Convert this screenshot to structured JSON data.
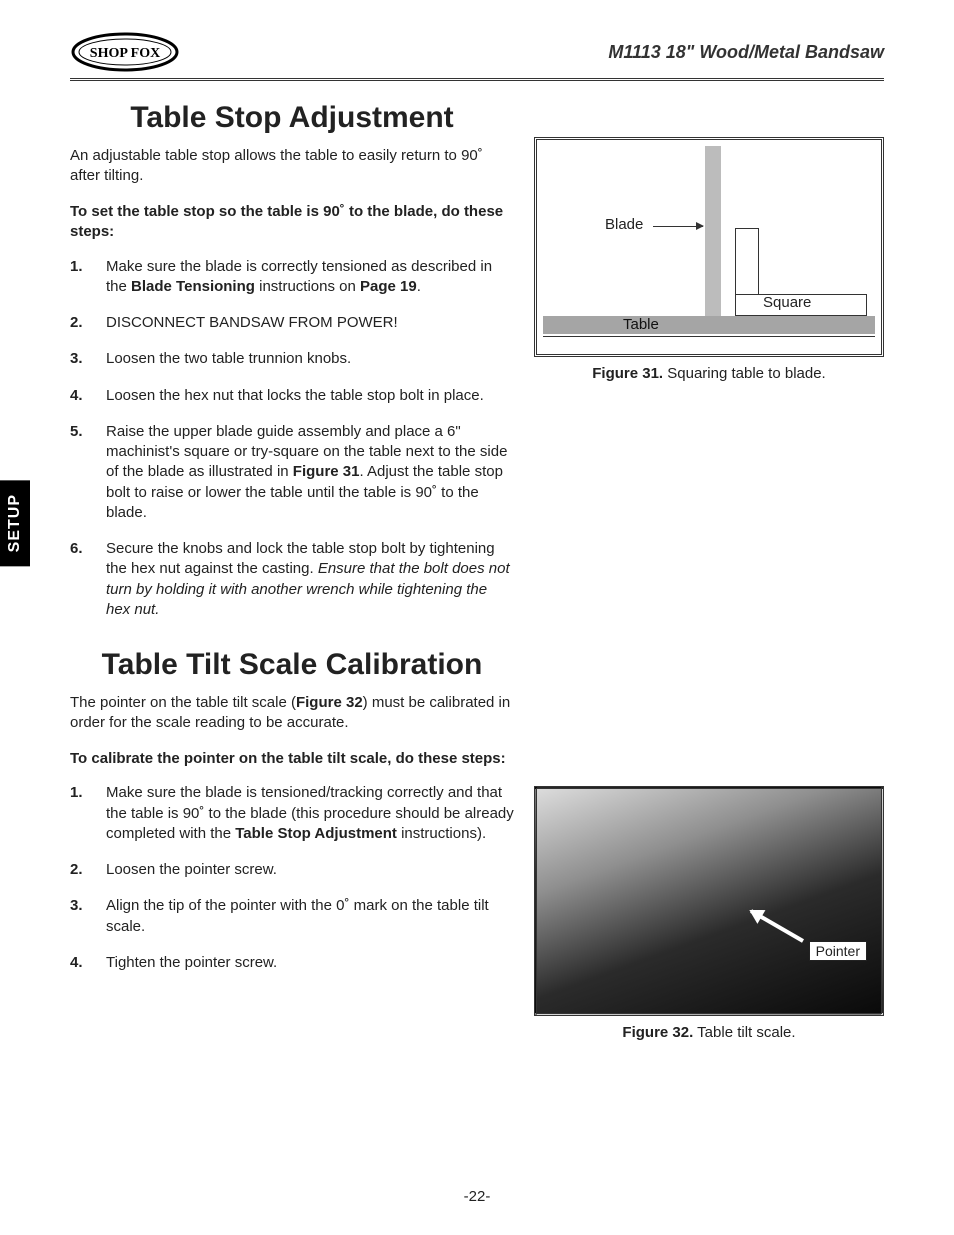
{
  "header": {
    "logo_text": "SHOP FOX",
    "doc_title": "M1113 18\" Wood/Metal Bandsaw"
  },
  "side_tab": "SETUP",
  "section1": {
    "title": "Table Stop Adjustment",
    "intro": "An adjustable table stop allows the table to easily return to 90˚ after tilting.",
    "lead": "To set the table stop so the table is 90˚ to the blade, do these steps:",
    "steps": {
      "s1a": "Make sure the blade is correctly tensioned as described in the ",
      "s1b": "Blade Tensioning",
      "s1c": " instructions on ",
      "s1d": "Page 19",
      "s1e": ".",
      "s2": "DISCONNECT BANDSAW FROM POWER!",
      "s3": "Loosen the two table trunnion knobs.",
      "s4": "Loosen the hex nut that locks the table stop bolt in place.",
      "s5a": "Raise the upper blade guide assembly and place a 6\" machinist's square or try-square on the table next to the side of the blade as illustrated in ",
      "s5b": "Figure 31",
      "s5c": ". Adjust the table stop bolt to raise or lower the table until the table is 90˚ to the blade.",
      "s6a": "Secure the knobs and lock the table stop bolt by tightening the hex nut against the casting. ",
      "s6b": "Ensure that the bolt does not turn by holding it with another wrench while tightening the hex nut."
    }
  },
  "section2": {
    "title": "Table Tilt Scale Calibration",
    "intro_a": "The pointer on the table tilt scale (",
    "intro_b": "Figure 32",
    "intro_c": ") must be calibrated in order for the scale reading to be accurate.",
    "lead": "To calibrate the pointer on the table tilt scale, do these steps:",
    "steps": {
      "s1a": "Make sure the blade is tensioned/tracking correctly and that the table is 90˚ to the blade (this procedure should be already completed with the ",
      "s1b": "Table Stop Adjustment",
      "s1c": " instructions).",
      "s2": "Loosen the pointer screw.",
      "s3": "Align the tip of the pointer with the 0˚ mark on the table tilt scale.",
      "s4": "Tighten the pointer screw."
    }
  },
  "figure31": {
    "blade": "Blade",
    "square": "Square",
    "table": "Table",
    "caption_b": "Figure 31.",
    "caption_t": " Squaring table to blade."
  },
  "figure32": {
    "pointer": "Pointer",
    "caption_b": "Figure 32.",
    "caption_t": " Table tilt scale."
  },
  "page_number": "-22-"
}
